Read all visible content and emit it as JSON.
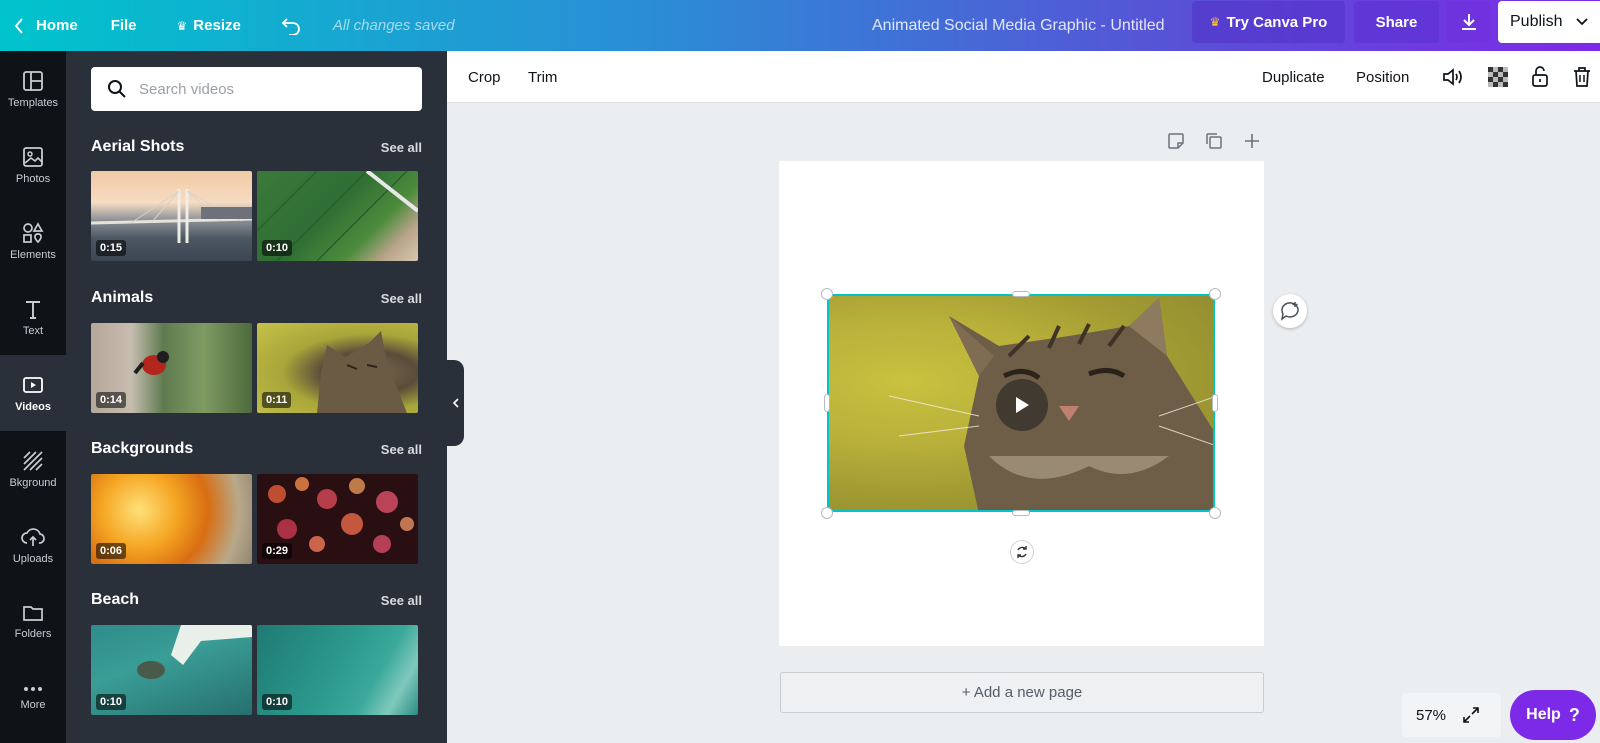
{
  "topbar": {
    "home": "Home",
    "file": "File",
    "resize": "Resize",
    "saved_status": "All changes saved",
    "doc_title": "Animated Social Media Graphic - Untitled",
    "try_pro": "Try Canva Pro",
    "share": "Share",
    "publish": "Publish"
  },
  "rail": {
    "items": [
      {
        "label": "Templates",
        "icon": "templates-icon"
      },
      {
        "label": "Photos",
        "icon": "photos-icon"
      },
      {
        "label": "Elements",
        "icon": "elements-icon"
      },
      {
        "label": "Text",
        "icon": "text-icon"
      },
      {
        "label": "Videos",
        "icon": "videos-icon",
        "active": true
      },
      {
        "label": "Bkground",
        "icon": "background-icon"
      },
      {
        "label": "Uploads",
        "icon": "uploads-icon"
      },
      {
        "label": "Folders",
        "icon": "folders-icon"
      },
      {
        "label": "More",
        "icon": "more-icon"
      }
    ]
  },
  "panel": {
    "search_placeholder": "Search videos",
    "sections": [
      {
        "title": "Aerial Shots",
        "see_all": "See all",
        "videos": [
          {
            "duration": "0:15"
          },
          {
            "duration": "0:10"
          }
        ]
      },
      {
        "title": "Animals",
        "see_all": "See all",
        "videos": [
          {
            "duration": "0:14"
          },
          {
            "duration": "0:11"
          }
        ]
      },
      {
        "title": "Backgrounds",
        "see_all": "See all",
        "videos": [
          {
            "duration": "0:06"
          },
          {
            "duration": "0:29"
          }
        ]
      },
      {
        "title": "Beach",
        "see_all": "See all",
        "videos": [
          {
            "duration": "0:10"
          },
          {
            "duration": "0:10"
          }
        ]
      }
    ]
  },
  "toolbar": {
    "crop": "Crop",
    "trim": "Trim",
    "duplicate": "Duplicate",
    "position": "Position"
  },
  "canvas": {
    "add_page": "+ Add a new page"
  },
  "footer": {
    "zoom": "57%",
    "help": "Help",
    "help_mark": "?"
  },
  "colors": {
    "accent_purple": "#7d2ae8",
    "selection": "#00c4cc",
    "panel_bg": "#293039",
    "rail_bg": "#0e1318"
  }
}
